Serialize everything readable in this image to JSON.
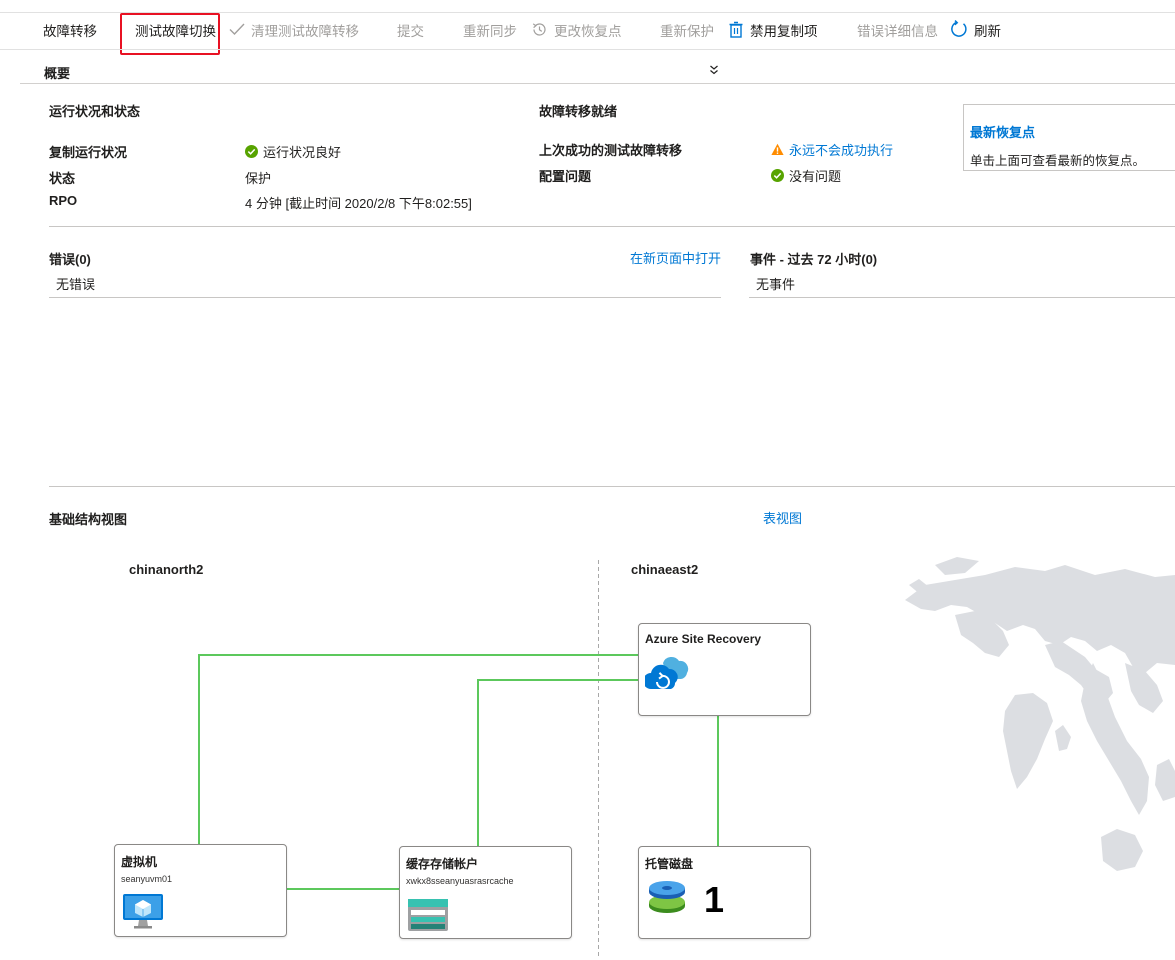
{
  "toolbar": {
    "failover": "故障转移",
    "test_failover": "测试故障切换",
    "cleanup_test_failover": "清理测试故障转移",
    "commit": "提交",
    "resync": "重新同步",
    "change_recovery_point": "更改恢复点",
    "reprotect": "重新保护",
    "disable_replication": "禁用复制项",
    "error_details": "错误详细信息",
    "refresh": "刷新"
  },
  "overview": {
    "title": "概要"
  },
  "health": {
    "heading": "运行状况和状态",
    "rows": [
      {
        "label": "复制运行状况",
        "value": "运行状况良好"
      },
      {
        "label": "状态",
        "value": "保护"
      },
      {
        "label": "RPO",
        "value": "4 分钟 [截止时间 2020/2/8 下午8:02:55]"
      }
    ]
  },
  "failover_readiness": {
    "heading": "故障转移就绪",
    "rows": [
      {
        "label": "上次成功的测试故障转移",
        "value": "永远不会成功执行"
      },
      {
        "label": "配置问题",
        "value": "没有问题"
      }
    ]
  },
  "latest_recovery": {
    "title": "最新恢复点",
    "description": "单击上面可查看最新的恢复点。"
  },
  "errors": {
    "heading": "错误(0)",
    "open_link": "在新页面中打开",
    "empty": "无错误"
  },
  "events": {
    "heading": "事件 - 过去 72 小时(0)",
    "empty": "无事件"
  },
  "infra": {
    "heading": "基础结构视图",
    "table_view_link": "表视图",
    "source_region": "chinanorth2",
    "target_region": "chinaeast2",
    "asr_card": {
      "title": "Azure Site Recovery"
    },
    "vm_card": {
      "title": "虚拟机",
      "subtitle": "seanyuvm01"
    },
    "cache_card": {
      "title": "缓存存储帐户",
      "subtitle": "xwkx8sseanyuasrasrcache"
    },
    "disk_card": {
      "title": "托管磁盘",
      "count": "1"
    }
  },
  "colors": {
    "accent": "#0078d4",
    "ok_green": "#57a300",
    "warning_orange": "#ff8c00",
    "highlight_red": "#e81123",
    "connector_green": "#5cc85c",
    "map_gray": "#dcdee2"
  }
}
